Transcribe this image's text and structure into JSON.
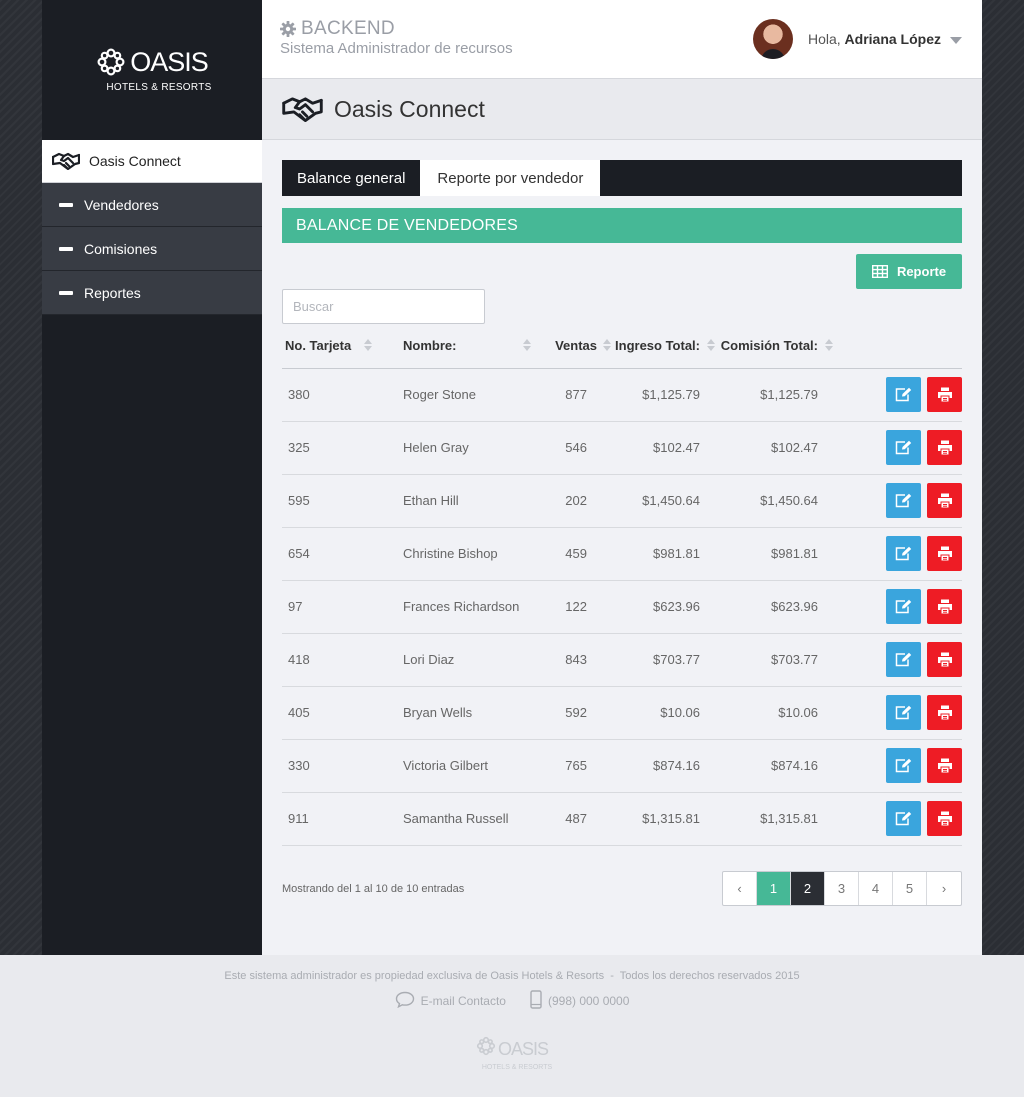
{
  "brand": {
    "logo_word": "OASIS",
    "logo_sub": "HOTELS & RESORTS"
  },
  "header": {
    "title": "BACKEND",
    "subtitle": "Sistema Administrador de recursos",
    "greeting": "Hola,",
    "user_name": "Adriana López"
  },
  "sidebar": {
    "active_item": "Oasis Connect",
    "items": [
      {
        "label": "Vendedores"
      },
      {
        "label": "Comisiones"
      },
      {
        "label": "Reportes"
      }
    ]
  },
  "page": {
    "title": "Oasis Connect"
  },
  "tabs": [
    {
      "label": "Balance general",
      "active": false
    },
    {
      "label": "Reporte por vendedor",
      "active": true
    }
  ],
  "section": {
    "title": "BALANCE DE VENDEDORES",
    "report_button": "Reporte",
    "search_placeholder": "Buscar"
  },
  "table": {
    "columns": [
      "No. Tarjeta",
      "Nombre:",
      "Ventas",
      "Ingreso Total:",
      "Comisión Total:"
    ],
    "rows": [
      {
        "card": "380",
        "name": "Roger Stone",
        "sales": "877",
        "income": "$1,125.79",
        "commission": "$1,125.79"
      },
      {
        "card": "325",
        "name": "Helen Gray",
        "sales": "546",
        "income": "$102.47",
        "commission": "$102.47"
      },
      {
        "card": "595",
        "name": "Ethan Hill",
        "sales": "202",
        "income": "$1,450.64",
        "commission": "$1,450.64"
      },
      {
        "card": "654",
        "name": "Christine Bishop",
        "sales": "459",
        "income": "$981.81",
        "commission": "$981.81"
      },
      {
        "card": "97",
        "name": "Frances Richardson",
        "sales": "122",
        "income": "$623.96",
        "commission": "$623.96"
      },
      {
        "card": "418",
        "name": "Lori Diaz",
        "sales": "843",
        "income": "$703.77",
        "commission": "$703.77"
      },
      {
        "card": "405",
        "name": "Bryan Wells",
        "sales": "592",
        "income": "$10.06",
        "commission": "$10.06"
      },
      {
        "card": "330",
        "name": "Victoria Gilbert",
        "sales": "765",
        "income": "$874.16",
        "commission": "$874.16"
      },
      {
        "card": "911",
        "name": "Samantha Russell",
        "sales": "487",
        "income": "$1,315.81",
        "commission": "$1,315.81"
      }
    ]
  },
  "pagination": {
    "info": "Mostrando del 1 al 10 de 10 entradas",
    "prev": "‹",
    "next": "›",
    "pages": [
      "1",
      "2",
      "3",
      "4",
      "5"
    ],
    "current": "1"
  },
  "footer": {
    "notice": "Este sistema administrador es propiedad exclusiva de Oasis Hotels & Resorts",
    "separator": "-",
    "rights": "Todos los derechos reservados 2015",
    "email_label": "E-mail Contacto",
    "phone": "(998) 000 0000",
    "logo_word": "OASIS",
    "logo_sub": "HOTELS & RESORTS"
  },
  "colors": {
    "accent": "#46b896",
    "edit": "#3aa5dd",
    "print": "#ee1c25",
    "dark": "#1b1e24"
  }
}
